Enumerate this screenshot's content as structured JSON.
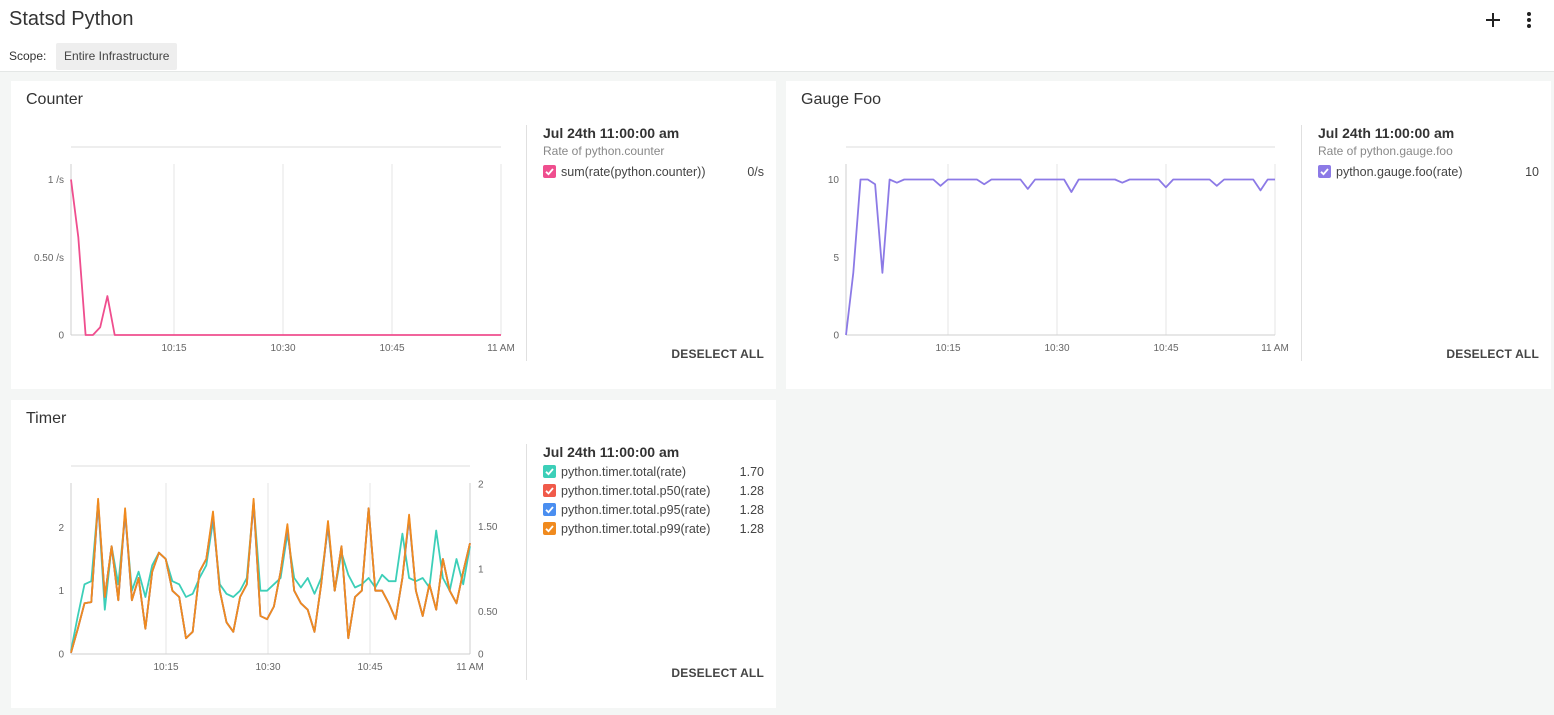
{
  "header": {
    "title": "Statsd Python",
    "scope_label": "Scope:",
    "scope_value": "Entire Infrastructure"
  },
  "panels": [
    {
      "title": "Counter",
      "legend": {
        "date": "Jul 24th 11:00:00 am",
        "subtitle": "Rate of python.counter",
        "items": [
          {
            "name": "sum(rate(python.counter))",
            "value": "0/s",
            "color": "#ef4e8e"
          }
        ],
        "deselect": "DESELECT ALL"
      }
    },
    {
      "title": "Gauge  Foo",
      "legend": {
        "date": "Jul 24th 11:00:00 am",
        "subtitle": "Rate of python.gauge.foo",
        "items": [
          {
            "name": "python.gauge.foo(rate)",
            "value": "10",
            "color": "#8c7ae6"
          }
        ],
        "deselect": "DESELECT ALL"
      }
    },
    {
      "title": "Timer",
      "legend": {
        "date": "Jul 24th 11:00:00 am",
        "subtitle": "",
        "items": [
          {
            "name": "python.timer.total(rate)",
            "value": "1.70",
            "color": "#3ccfb8"
          },
          {
            "name": "python.timer.total.p50(rate)",
            "value": "1.28",
            "color": "#f05a4a"
          },
          {
            "name": "python.timer.total.p95(rate)",
            "value": "1.28",
            "color": "#4a8ef0"
          },
          {
            "name": "python.timer.total.p99(rate)",
            "value": "1.28",
            "color": "#f08a1e"
          }
        ],
        "deselect": "DESELECT ALL"
      }
    }
  ],
  "chart_data": [
    {
      "type": "line",
      "title": "Counter",
      "x_ticks": [
        "10:15",
        "10:30",
        "10:45",
        "11 AM"
      ],
      "y_ticks": [
        "0",
        "0.50 /s",
        "1 /s"
      ],
      "ylim": [
        0,
        1.1
      ],
      "xlim": [
        0,
        59
      ],
      "series": [
        {
          "name": "sum(rate(python.counter))",
          "color": "#ef4e8e",
          "values": [
            1.0,
            0.63,
            0.0,
            0.0,
            0.05,
            0.25,
            0,
            0,
            0,
            0,
            0,
            0,
            0,
            0,
            0,
            0,
            0,
            0,
            0,
            0,
            0,
            0,
            0,
            0,
            0,
            0,
            0,
            0,
            0,
            0,
            0,
            0,
            0,
            0,
            0,
            0,
            0,
            0,
            0,
            0,
            0,
            0,
            0,
            0,
            0,
            0,
            0,
            0,
            0,
            0,
            0,
            0,
            0,
            0,
            0,
            0,
            0,
            0,
            0,
            0
          ]
        }
      ]
    },
    {
      "type": "line",
      "title": "Gauge  Foo",
      "x_ticks": [
        "10:15",
        "10:30",
        "10:45",
        "11 AM"
      ],
      "y_ticks": [
        "0",
        "5",
        "10"
      ],
      "ylim": [
        0,
        11
      ],
      "xlim": [
        0,
        59
      ],
      "series": [
        {
          "name": "python.gauge.foo(rate)",
          "color": "#8c7ae6",
          "values": [
            0,
            4,
            10,
            10,
            9.7,
            4,
            10,
            9.8,
            10,
            10,
            10,
            10,
            10,
            9.6,
            10,
            10,
            10,
            10,
            10,
            9.7,
            10,
            10,
            10,
            10,
            10,
            9.4,
            10,
            10,
            10,
            10,
            10,
            9.2,
            10,
            10,
            10,
            10,
            10,
            10,
            9.8,
            10,
            10,
            10,
            10,
            10,
            9.5,
            10,
            10,
            10,
            10,
            10,
            10,
            9.6,
            10,
            10,
            10,
            10,
            10,
            9.3,
            10,
            10
          ]
        }
      ]
    },
    {
      "type": "line",
      "title": "Timer",
      "x_ticks": [
        "10:15",
        "10:30",
        "10:45",
        "11 AM"
      ],
      "y_ticks": [
        "0",
        "1",
        "2"
      ],
      "y2_ticks": [
        "0",
        "0.50",
        "1",
        "1.50",
        "2"
      ],
      "ylim": [
        0,
        2.7
      ],
      "xlim": [
        0,
        59
      ],
      "series": [
        {
          "name": "python.timer.total(rate)",
          "color": "#3ccfb8",
          "values": [
            0.05,
            0.6,
            1.1,
            1.15,
            2.4,
            0.7,
            1.7,
            1.1,
            2.2,
            1.0,
            1.3,
            0.9,
            1.4,
            1.6,
            1.5,
            1.15,
            1.1,
            0.9,
            0.95,
            1.2,
            1.4,
            2.1,
            1.1,
            0.95,
            0.9,
            1.0,
            1.2,
            2.4,
            1.0,
            1.0,
            1.1,
            1.2,
            1.9,
            1.2,
            1.05,
            1.2,
            0.95,
            1.2,
            2.0,
            1.0,
            1.6,
            1.25,
            1.05,
            1.1,
            1.2,
            1.05,
            1.25,
            1.15,
            1.15,
            1.9,
            1.2,
            1.15,
            1.2,
            1.05,
            1.95,
            1.2,
            1.0,
            1.5,
            1.1,
            1.7
          ]
        },
        {
          "name": "python.timer.total.p50(rate)",
          "color": "#f05a4a",
          "values": [
            0.02,
            0.4,
            0.8,
            0.82,
            2.4,
            0.9,
            1.7,
            0.85,
            2.25,
            0.85,
            1.2,
            0.4,
            1.3,
            1.6,
            1.5,
            1.0,
            0.9,
            0.25,
            0.35,
            1.3,
            1.5,
            2.2,
            1.0,
            0.5,
            0.35,
            0.9,
            1.1,
            2.4,
            0.6,
            0.55,
            0.75,
            1.3,
            2.0,
            1.0,
            0.8,
            0.7,
            0.35,
            1.1,
            2.05,
            1.0,
            1.7,
            0.25,
            0.9,
            1.0,
            2.3,
            1.0,
            1.0,
            0.8,
            0.55,
            1.2,
            2.15,
            1.0,
            0.6,
            1.1,
            0.7,
            1.5,
            1.0,
            0.8,
            1.3,
            1.75
          ]
        },
        {
          "name": "python.timer.total.p95(rate)",
          "color": "#4a8ef0",
          "values": [
            0.02,
            0.4,
            0.8,
            0.82,
            2.4,
            0.9,
            1.7,
            0.85,
            2.25,
            0.85,
            1.2,
            0.4,
            1.3,
            1.6,
            1.5,
            1.0,
            0.9,
            0.25,
            0.35,
            1.3,
            1.5,
            2.2,
            1.0,
            0.5,
            0.35,
            0.9,
            1.1,
            2.4,
            0.6,
            0.55,
            0.75,
            1.3,
            2.0,
            1.0,
            0.8,
            0.7,
            0.35,
            1.1,
            2.05,
            1.0,
            1.7,
            0.25,
            0.9,
            1.0,
            2.3,
            1.0,
            1.0,
            0.8,
            0.55,
            1.2,
            2.15,
            1.0,
            0.6,
            1.1,
            0.7,
            1.5,
            1.0,
            0.8,
            1.3,
            1.75
          ]
        },
        {
          "name": "python.timer.total.p99(rate)",
          "color": "#f08a1e",
          "values": [
            0.02,
            0.4,
            0.8,
            0.82,
            2.45,
            0.9,
            1.7,
            0.85,
            2.3,
            0.85,
            1.2,
            0.4,
            1.3,
            1.6,
            1.5,
            1.0,
            0.9,
            0.25,
            0.35,
            1.3,
            1.5,
            2.25,
            1.0,
            0.5,
            0.35,
            0.9,
            1.1,
            2.45,
            0.6,
            0.55,
            0.75,
            1.3,
            2.05,
            1.0,
            0.8,
            0.7,
            0.35,
            1.1,
            2.1,
            1.0,
            1.7,
            0.25,
            0.9,
            1.0,
            2.3,
            1.0,
            1.0,
            0.8,
            0.55,
            1.2,
            2.2,
            1.0,
            0.6,
            1.1,
            0.7,
            1.5,
            1.0,
            0.8,
            1.3,
            1.75
          ]
        }
      ]
    }
  ]
}
